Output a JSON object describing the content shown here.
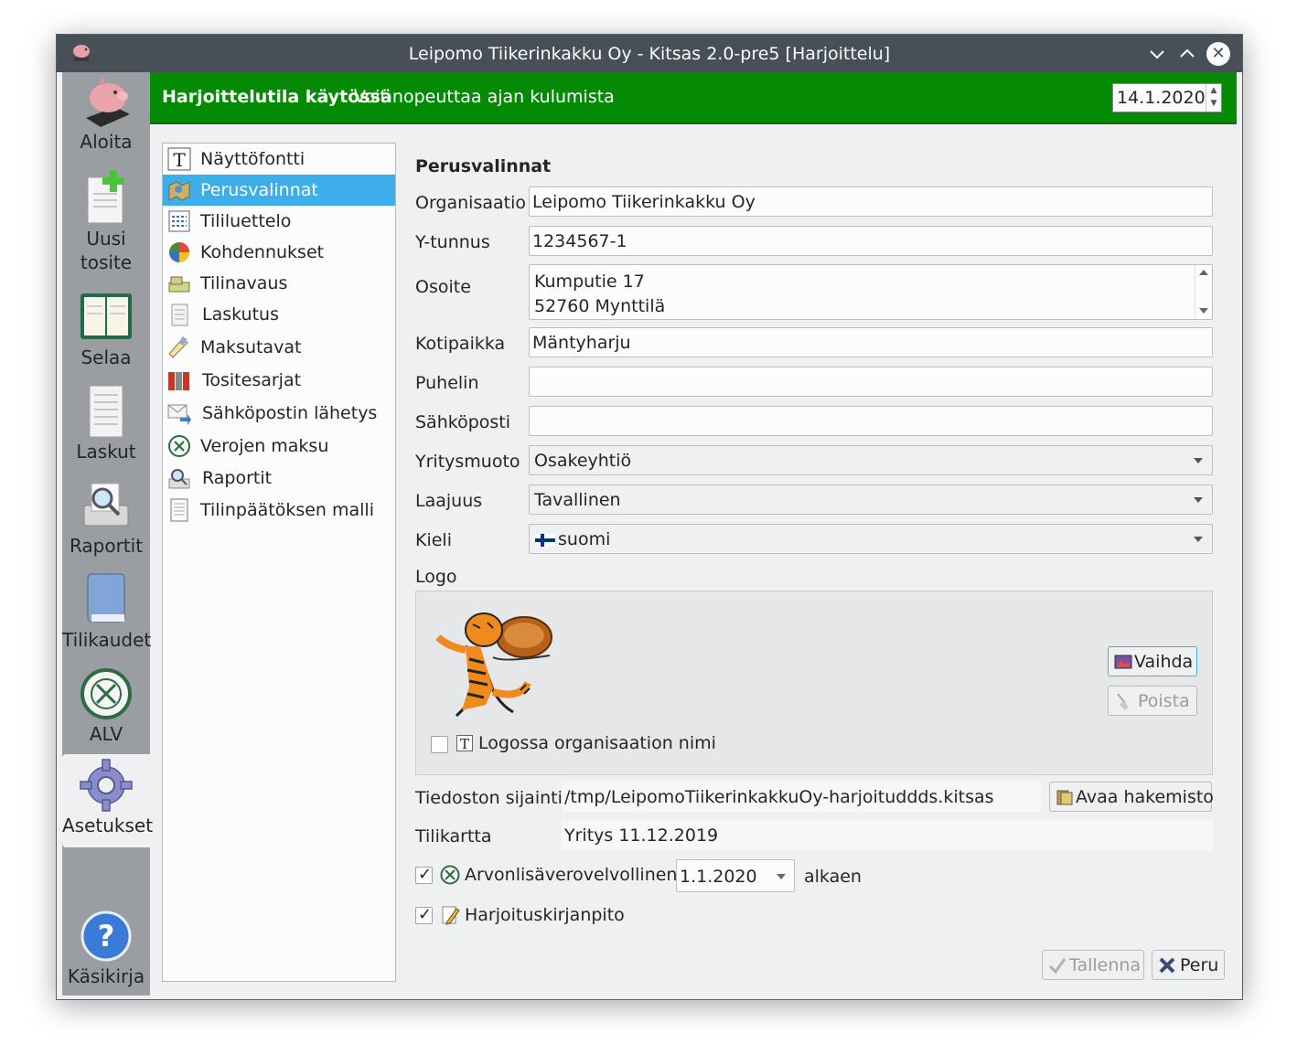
{
  "window": {
    "title": "Leipomo Tiikerinkakku Oy - Kitsas 2.0-pre5 [Harjoittelu]"
  },
  "sidebar": {
    "items": [
      {
        "label": "Aloita"
      },
      {
        "label": "Uusi tosite"
      },
      {
        "label": "Selaa"
      },
      {
        "label": "Laskut"
      },
      {
        "label": "Raportit"
      },
      {
        "label": "Tilikaudet"
      },
      {
        "label": "ALV"
      },
      {
        "label": "Asetukset"
      },
      {
        "label": "Käsikirja"
      }
    ]
  },
  "banner": {
    "bold": "Harjoittelutila käytössä",
    "text": "Voit nopeuttaa ajan kulumista",
    "date": "14.1.2020"
  },
  "categories": [
    {
      "label": "Näyttöfontti"
    },
    {
      "label": "Perusvalinnat"
    },
    {
      "label": "Tililuettelo"
    },
    {
      "label": "Kohdennukset"
    },
    {
      "label": "Tilinavaus"
    },
    {
      "label": "Laskutus"
    },
    {
      "label": "Maksutavat"
    },
    {
      "label": "Tositesarjat"
    },
    {
      "label": "Sähköpostin lähetys"
    },
    {
      "label": "Verojen maksu"
    },
    {
      "label": "Raportit"
    },
    {
      "label": "Tilinpäätöksen malli"
    }
  ],
  "form": {
    "section_title": "Perusvalinnat",
    "organisaatio_label": "Organisaatio",
    "organisaatio_value": "Leipomo Tiikerinkakku Oy",
    "ytunnus_label": "Y-tunnus",
    "ytunnus_value": "1234567-1",
    "osoite_label": "Osoite",
    "osoite_line1": "Kumputie 17",
    "osoite_line2": "52760 Mynttilä",
    "kotipaikka_label": "Kotipaikka",
    "kotipaikka_value": "Mäntyharju",
    "puhelin_label": "Puhelin",
    "puhelin_value": "",
    "sahkoposti_label": "Sähköposti",
    "sahkoposti_value": "",
    "yritysmuoto_label": "Yritysmuoto",
    "yritysmuoto_value": "Osakeyhtiö",
    "laajuus_label": "Laajuus",
    "laajuus_value": "Tavallinen",
    "kieli_label": "Kieli",
    "kieli_value": "suomi",
    "logo_label": "Logo",
    "vaihda_label": "Vaihda",
    "poista_label": "Poista",
    "logo_name_checkbox": "Logossa organisaation nimi",
    "tiedosto_label": "Tiedoston sijainti",
    "tiedosto_value": "/tmp/LeipomoTiikerinkakkuOy-harjoituddds.kitsas",
    "avaa_label": "Avaa hakemisto",
    "tilikartta_label": "Tilikartta",
    "tilikartta_value": "Yritys 11.12.2019",
    "alv_label": "Arvonlisäverovelvollinen",
    "alv_date": "1.1.2020",
    "alkaen_label": "alkaen",
    "harjoitus_label": "Harjoituskirjanpito",
    "tallenna_label": "Tallenna",
    "peru_label": "Peru"
  },
  "colors": {
    "banner": "#058a05",
    "selection": "#3daee9",
    "titlebar": "#475057",
    "sidebar": "#9a9ea2"
  }
}
